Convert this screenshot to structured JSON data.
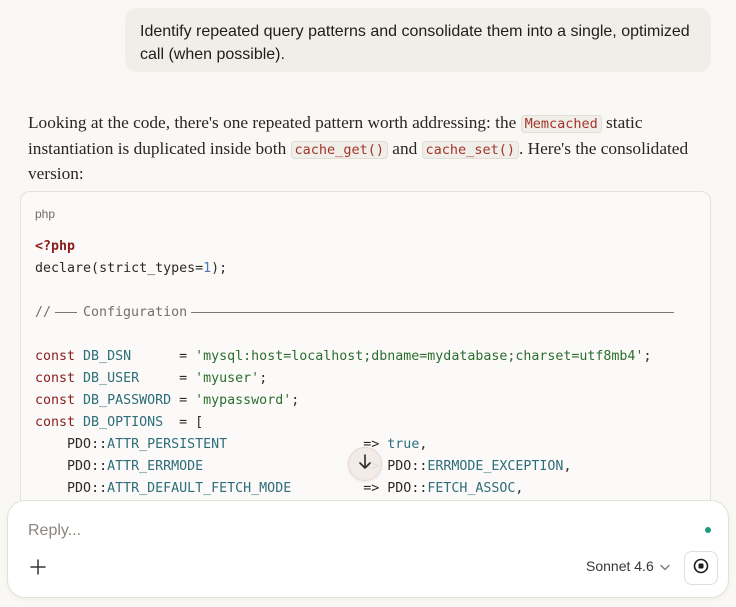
{
  "user_message": "Identify repeated query patterns and consolidate them into a single, optimized call (when possible).",
  "assistant": {
    "p_part1": "Looking at the code, there's one repeated pattern worth addressing: the ",
    "code1": "Memcached",
    "p_part2": " static instantiation is duplicated inside both ",
    "code2": "cache_get()",
    "p_part3": " and ",
    "code3": "cache_set()",
    "p_part4": ". Here's the consolidated version:"
  },
  "code_block": {
    "language": "php",
    "open_tag": "<?php",
    "declare_fn": "declare",
    "declare_arg": "strict_types",
    "declare_val": "1",
    "comment_prefix": "//",
    "comment_label": "Configuration",
    "consts": [
      {
        "kw": "const",
        "name": "DB_DSN     ",
        "value": "'mysql:host=localhost;dbname=mydatabase;charset=utf8mb4'"
      },
      {
        "kw": "const",
        "name": "DB_USER    ",
        "value": "'myuser'"
      },
      {
        "kw": "const",
        "name": "DB_PASSWORD",
        "value": "'mypassword'"
      },
      {
        "kw": "const",
        "name": "DB_OPTIONS "
      }
    ],
    "options": [
      {
        "cls": "PDO",
        "key": "ATTR_PERSISTENT",
        "arrow": "=>",
        "value": "true"
      },
      {
        "cls": "PDO",
        "key": "ATTR_ERRMODE",
        "arrow": "=>",
        "value_cls": "PDO",
        "value": "ERRMODE_EXCEPTION"
      },
      {
        "cls": "PDO",
        "key": "ATTR_DEFAULT_FETCH_MODE",
        "arrow": "=>",
        "value_cls": "PDO",
        "value": "FETCH_ASSOC"
      }
    ]
  },
  "scroll_icon": "arrow-down-icon",
  "composer": {
    "placeholder": "Reply...",
    "model_label": "Sonnet 4.6",
    "add_icon": "plus-icon",
    "model_chevron_icon": "chevron-down-icon",
    "stop_icon": "stop-icon"
  },
  "colors": {
    "background": "#f9f8f5",
    "user_bubble": "#f0eee8",
    "inline_code": "#a3342a",
    "keyword": "#8b1c1c",
    "string": "#2c6e2e",
    "number": "#4f7ab0",
    "status_dot": "#1f9a7a"
  }
}
